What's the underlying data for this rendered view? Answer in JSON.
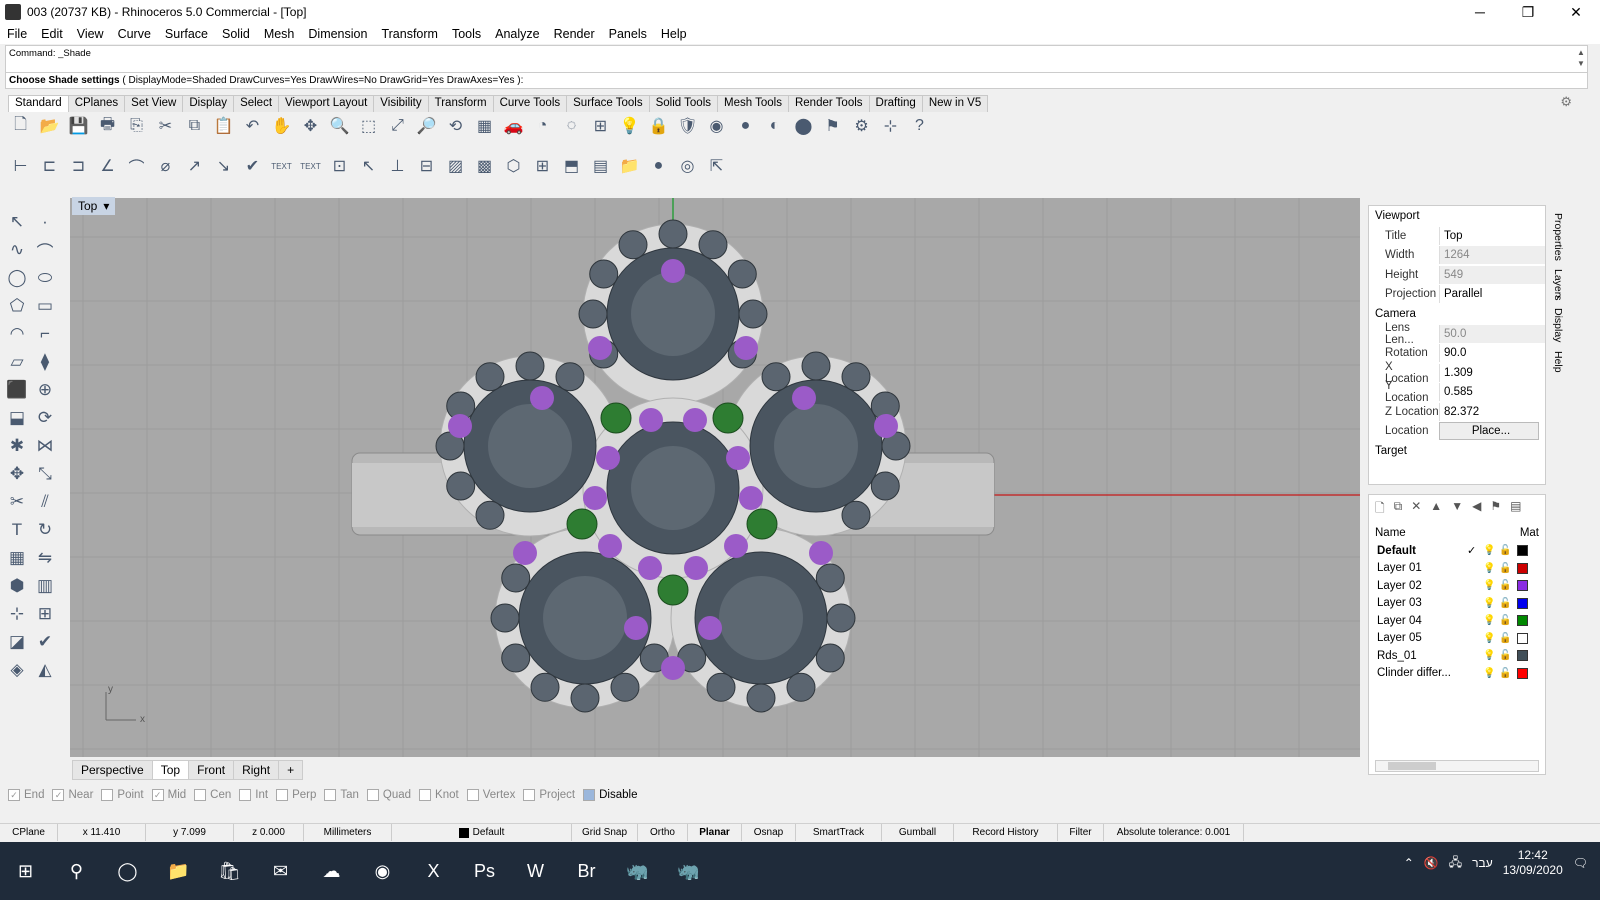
{
  "window": {
    "title": "003 (20737 KB) - Rhinoceros 5.0 Commercial - [Top]",
    "minimize": "─",
    "maximize": "❐",
    "close": "✕"
  },
  "menu": [
    "File",
    "Edit",
    "View",
    "Curve",
    "Surface",
    "Solid",
    "Mesh",
    "Dimension",
    "Transform",
    "Tools",
    "Analyze",
    "Render",
    "Panels",
    "Help"
  ],
  "command": {
    "history": "Command: _Shade",
    "prompt_label": "Choose Shade settings",
    "prompt_options": "( DisplayMode=Shaded  DrawCurves=Yes  DrawWires=No  DrawGrid=Yes  DrawAxes=Yes ):"
  },
  "toolbar_tabs": [
    "Standard",
    "CPlanes",
    "Set View",
    "Display",
    "Select",
    "Viewport Layout",
    "Visibility",
    "Transform",
    "Curve Tools",
    "Surface Tools",
    "Solid Tools",
    "Mesh Tools",
    "Render Tools",
    "Drafting",
    "New in V5"
  ],
  "toolbar_active_tab": "Standard",
  "toolbar1_icons": [
    "new-file-icon",
    "open-file-icon",
    "save-icon",
    "print-icon",
    "import-icon",
    "cut-icon",
    "copy-icon",
    "paste-icon",
    "undo-icon",
    "pan-icon",
    "move-icon",
    "zoom-icon",
    "zoom-window-icon",
    "zoom-extents-icon",
    "zoom-selected-icon",
    "rotate-view-icon",
    "four-views-icon",
    "car-icon",
    "ghost-icon",
    "grid-icon",
    "cplane-icon",
    "light-bulb-icon",
    "lock-icon",
    "layer-icon",
    "color-wheel-icon",
    "shade-icon",
    "render-preview-icon",
    "sphere-icon",
    "lamp-icon",
    "options-gear-icon",
    "dimension-icon",
    "help-icon"
  ],
  "toolbar1_glyphs": [
    "🗋",
    "📂",
    "💾",
    "🖶",
    "⎘",
    "✂",
    "⧉",
    "📋",
    "↶",
    "✋",
    "✥",
    "🔍",
    "⬚",
    "⤢",
    "🔎",
    "⟲",
    "▦",
    "🚗",
    "◔",
    "◌",
    "⊞",
    "💡",
    "🔒",
    "🛡",
    "◉",
    "●",
    "◐",
    "⬤",
    "⚑",
    "⚙",
    "⊹",
    "?"
  ],
  "toolbar2_icons": [
    "dim-linear-icon",
    "dim-aligned-icon",
    "dim-rotated-icon",
    "dim-angle-icon",
    "dim-radius-icon",
    "dim-diameter-icon",
    "dim-leader-icon",
    "dim-text-icon",
    "checkmark-icon",
    "text-icon",
    "text-object-icon",
    "annotation-icon",
    "leader-icon",
    "ordinate-icon",
    "dim-style-icon",
    "hatch-icon",
    "hatch-fill-icon",
    "block-icon",
    "detail-icon",
    "box-icon",
    "table-icon",
    "folder-icon",
    "dot-icon",
    "spiral-icon",
    "export-icon"
  ],
  "toolbar2_glyphs": [
    "⊢",
    "⊏",
    "⊐",
    "∠",
    "⌒",
    "⌀",
    "↗",
    "↘",
    "✔",
    "TEXT",
    "TEXT",
    "⊡",
    "↖",
    "⊥",
    "⊟",
    "▨",
    "▩",
    "⬡",
    "⊞",
    "⬒",
    "▤",
    "📁",
    "●",
    "◎",
    "⇱"
  ],
  "left_tools": [
    "select-arrow-icon",
    "point-icon",
    "polyline-icon",
    "curve-icon",
    "circle-icon",
    "ellipse-icon",
    "polygon-icon",
    "rectangle-icon",
    "arc-icon",
    "fillet-icon",
    "surface-icon",
    "loft-icon",
    "box-solid-icon",
    "boolean-icon",
    "extrude-icon",
    "revolve-icon",
    "explode-icon",
    "join-icon",
    "move-tool-icon",
    "scale-icon",
    "trim-icon",
    "split-icon",
    "text-tool-icon",
    "rotate-tool-icon",
    "array-icon",
    "mirror-icon",
    "solid-tool-icon",
    "grid-snap-icon",
    "snap-icon",
    "group-icon",
    "analyze-icon",
    "check-icon",
    "render-icon",
    "material-icon"
  ],
  "left_glyphs": [
    "↖",
    "·",
    "∿",
    "⌒",
    "◯",
    "⬭",
    "⬠",
    "▭",
    "◠",
    "⌐",
    "▱",
    "⧫",
    "⬛",
    "⊕",
    "⬓",
    "⟳",
    "✱",
    "⋈",
    "✥",
    "⤡",
    "✂",
    "⫽",
    "T",
    "↻",
    "▦",
    "⇋",
    "⬢",
    "▥",
    "⊹",
    "⊞",
    "◪",
    "✔",
    "◈",
    "◭"
  ],
  "viewport": {
    "label": "Top",
    "dropdown": "▾",
    "axis_x": "x",
    "axis_y": "y"
  },
  "viewport_tabs": [
    "Perspective",
    "Top",
    "Front",
    "Right"
  ],
  "viewport_active_tab": "Top",
  "viewport_add": "+",
  "osnaps": [
    {
      "label": "End",
      "checked": true
    },
    {
      "label": "Near",
      "checked": true
    },
    {
      "label": "Point",
      "checked": false
    },
    {
      "label": "Mid",
      "checked": true
    },
    {
      "label": "Cen",
      "checked": false
    },
    {
      "label": "Int",
      "checked": false
    },
    {
      "label": "Perp",
      "checked": false
    },
    {
      "label": "Tan",
      "checked": false
    },
    {
      "label": "Quad",
      "checked": false
    },
    {
      "label": "Knot",
      "checked": false
    },
    {
      "label": "Vertex",
      "checked": false
    },
    {
      "label": "Project",
      "checked": false
    },
    {
      "label": "Disable",
      "checked": false
    }
  ],
  "status": [
    {
      "label": "CPlane"
    },
    {
      "label": "x 11.410"
    },
    {
      "label": "y 7.099"
    },
    {
      "label": "z 0.000"
    },
    {
      "label": "Millimeters"
    },
    {
      "label": "Default"
    },
    {
      "label": "Grid Snap"
    },
    {
      "label": "Ortho"
    },
    {
      "label": "Planar"
    },
    {
      "label": "Osnap"
    },
    {
      "label": "SmartTrack"
    },
    {
      "label": "Gumball"
    },
    {
      "label": "Record History"
    },
    {
      "label": "Filter"
    },
    {
      "label": "Absolute tolerance: 0.001"
    }
  ],
  "properties": {
    "section_viewport": "Viewport",
    "rows": [
      {
        "key": "Title",
        "value": "Top",
        "dim": false
      },
      {
        "key": "Width",
        "value": "1264",
        "dim": true
      },
      {
        "key": "Height",
        "value": "549",
        "dim": true
      },
      {
        "key": "Projection",
        "value": "Parallel",
        "dim": false
      }
    ],
    "section_camera": "Camera",
    "camera_rows": [
      {
        "key": "Lens Len...",
        "value": "50.0",
        "dim": true
      },
      {
        "key": "Rotation",
        "value": "90.0",
        "dim": false
      },
      {
        "key": "X Location",
        "value": "1.309",
        "dim": false
      },
      {
        "key": "Y Location",
        "value": "0.585",
        "dim": false
      },
      {
        "key": "Z Location",
        "value": "82.372",
        "dim": false
      },
      {
        "key": "Location",
        "value": "Place...",
        "dim": false
      }
    ],
    "section_target": "Target"
  },
  "layers": {
    "header_name": "Name",
    "header_mat": "Mat",
    "items": [
      {
        "name": "Default",
        "color": "#000000",
        "bold": true,
        "current": "✓"
      },
      {
        "name": "Layer 01",
        "color": "#cc0000",
        "bold": false,
        "current": ""
      },
      {
        "name": "Layer 02",
        "color": "#8a2be2",
        "bold": false,
        "current": ""
      },
      {
        "name": "Layer 03",
        "color": "#0000ee",
        "bold": false,
        "current": ""
      },
      {
        "name": "Layer 04",
        "color": "#008800",
        "bold": false,
        "current": ""
      },
      {
        "name": "Layer 05",
        "color": "#ffffff",
        "bold": false,
        "current": ""
      },
      {
        "name": "Rds_01",
        "color": "#404e58",
        "bold": false,
        "current": ""
      },
      {
        "name": "Clinder differ...",
        "color": "#ff0000",
        "bold": false,
        "current": ""
      }
    ]
  },
  "side_tabs": [
    "Properties",
    "Layers",
    "Display",
    "Help"
  ],
  "taskbar": {
    "apps": [
      "windows-start-icon",
      "search-icon",
      "task-view-icon",
      "file-explorer-icon",
      "store-icon",
      "outlook-icon",
      "onedrive-icon",
      "chrome-icon",
      "excel-icon",
      "photoshop-icon",
      "word-icon",
      "bridge-icon",
      "rhino-icon",
      "rhino-alt-icon"
    ],
    "app_glyphs": [
      "⊞",
      "⚲",
      "◯",
      "📁",
      "🛍",
      "✉",
      "☁",
      "◉",
      "X",
      "Ps",
      "W",
      "Br",
      "🦏",
      "🦏"
    ],
    "lang": "עבר",
    "time": "12:42",
    "date": "13/09/2020"
  },
  "colors": {
    "viewport_bg": "#a8a8a8",
    "purple_gem": "#9b5bc8",
    "green_gem": "#2e7d32",
    "dark_gem": "#4a5560",
    "accent": "#1f2b3a"
  }
}
